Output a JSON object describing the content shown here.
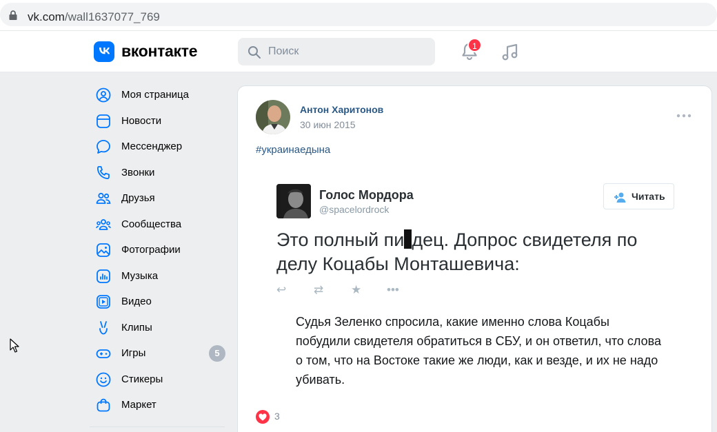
{
  "browser": {
    "url_host": "vk.com",
    "url_path": "/wall1637077_769"
  },
  "header": {
    "logo_text": "вконтакте",
    "search_placeholder": "Поиск",
    "notifications_count": "1"
  },
  "sidebar": {
    "items": [
      {
        "label": "Моя страница",
        "icon": "user-circle-icon"
      },
      {
        "label": "Новости",
        "icon": "news-icon"
      },
      {
        "label": "Мессенджер",
        "icon": "message-icon"
      },
      {
        "label": "Звонки",
        "icon": "phone-icon"
      },
      {
        "label": "Друзья",
        "icon": "friends-icon"
      },
      {
        "label": "Сообщества",
        "icon": "communities-icon"
      },
      {
        "label": "Фотографии",
        "icon": "photo-icon"
      },
      {
        "label": "Музыка",
        "icon": "music-icon"
      },
      {
        "label": "Видео",
        "icon": "video-icon"
      },
      {
        "label": "Клипы",
        "icon": "clips-icon"
      },
      {
        "label": "Игры",
        "icon": "games-icon",
        "count": "5"
      },
      {
        "label": "Стикеры",
        "icon": "smile-icon"
      },
      {
        "label": "Маркет",
        "icon": "market-icon"
      }
    ]
  },
  "post": {
    "author": "Антон Харитонов",
    "date": "30 июн 2015",
    "hashtag": "#украинаедына",
    "likes": "3",
    "tweet": {
      "name": "Голос Мордора",
      "handle": "@spacelordrock",
      "follow_label": "Читать",
      "text_part1": "Это полный пи",
      "text_part2": "дец. Допрос свидетеля по делу Коцабы Монташевича:",
      "quote": "Судья Зеленко спросила, какие именно слова Коцабы побудили свидетеля обратиться в СБУ, и он ответил, что слова о том, что на Востоке такие же люди, как и везде, и их не надо убивать."
    }
  },
  "colors": {
    "vk_blue": "#0077ff",
    "link": "#2a5885",
    "badge_red": "#ff3347"
  }
}
